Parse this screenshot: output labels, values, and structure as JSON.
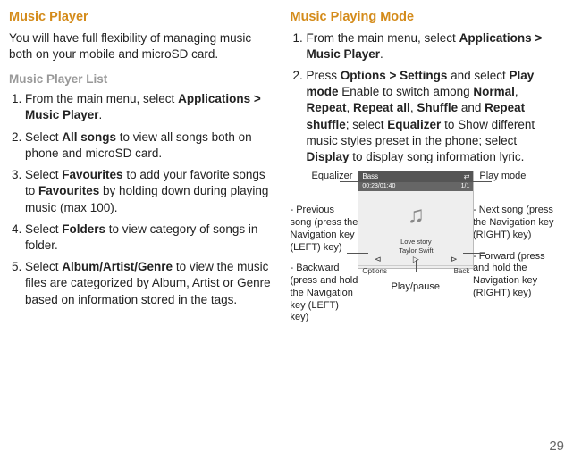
{
  "page_number": "29",
  "left": {
    "h1": "Music Player",
    "intro": "You will have full flexibility of managing music both on your mobile and microSD card.",
    "h2": "Music Player List",
    "items": [
      {
        "pre": "From the main menu, select ",
        "b": "Applications > Music Player",
        "post": "."
      },
      {
        "pre": "Select ",
        "b": "All songs",
        "post": " to view all songs both on phone and microSD card."
      },
      {
        "pre": "Select ",
        "b": "Favourites",
        "mid": " to add your favorite songs to ",
        "b2": "Favourites",
        "post": " by holding down during playing music (max 100)."
      },
      {
        "pre": "Select ",
        "b": "Folders",
        "post": " to view category of songs in folder."
      },
      {
        "pre": "Select ",
        "b": "Album/Artist/Genre",
        "post": " to view the music files are categorized by Album, Artist or Genre based on information stored in the tags."
      }
    ]
  },
  "right": {
    "h1": "Music Playing Mode",
    "items_html": {
      "1_pre": "From the main menu, select ",
      "1_b": "Applications > Music Player",
      "1_post": ".",
      "2_a": "Press ",
      "2_b1": "Options > Settings",
      "2_c": " and select ",
      "2_b2": "Play mode",
      "2_d": " Enable to switch among ",
      "2_b3": "Normal",
      "2_e": ", ",
      "2_b4": "Repeat",
      "2_f": ", ",
      "2_b5": "Repeat all",
      "2_g": ", ",
      "2_b6": "Shuffle",
      "2_h": " and ",
      "2_b7": "Repeat shuffle",
      "2_i": "; select ",
      "2_b8": "Equalizer",
      "2_j": " to Show different music styles preset in the phone; select ",
      "2_b9": "Display",
      "2_k": " to display song information lyric."
    }
  },
  "diagram": {
    "equalizer": "Equalizer",
    "playmode": "Play mode",
    "prev": "- Previous song (press the Navigation key (LEFT) key)",
    "back": "- Backward (press and hold the Navigation key (LEFT) key)",
    "next": "- Next song (press the Navigation key (RIGHT) key)",
    "fwd": "- Forward (press and hold the Navigation key (RIGHT) key)",
    "playpause": "Play/pause"
  },
  "phone": {
    "top_title": "Bass",
    "shuffle_icon": "⇄",
    "time_elapsed": "00:23/01:40",
    "track_index": "1/1",
    "song_title": "Love story",
    "artist": "Taylor Swift",
    "soft_left": "Options",
    "soft_right": "Back"
  }
}
